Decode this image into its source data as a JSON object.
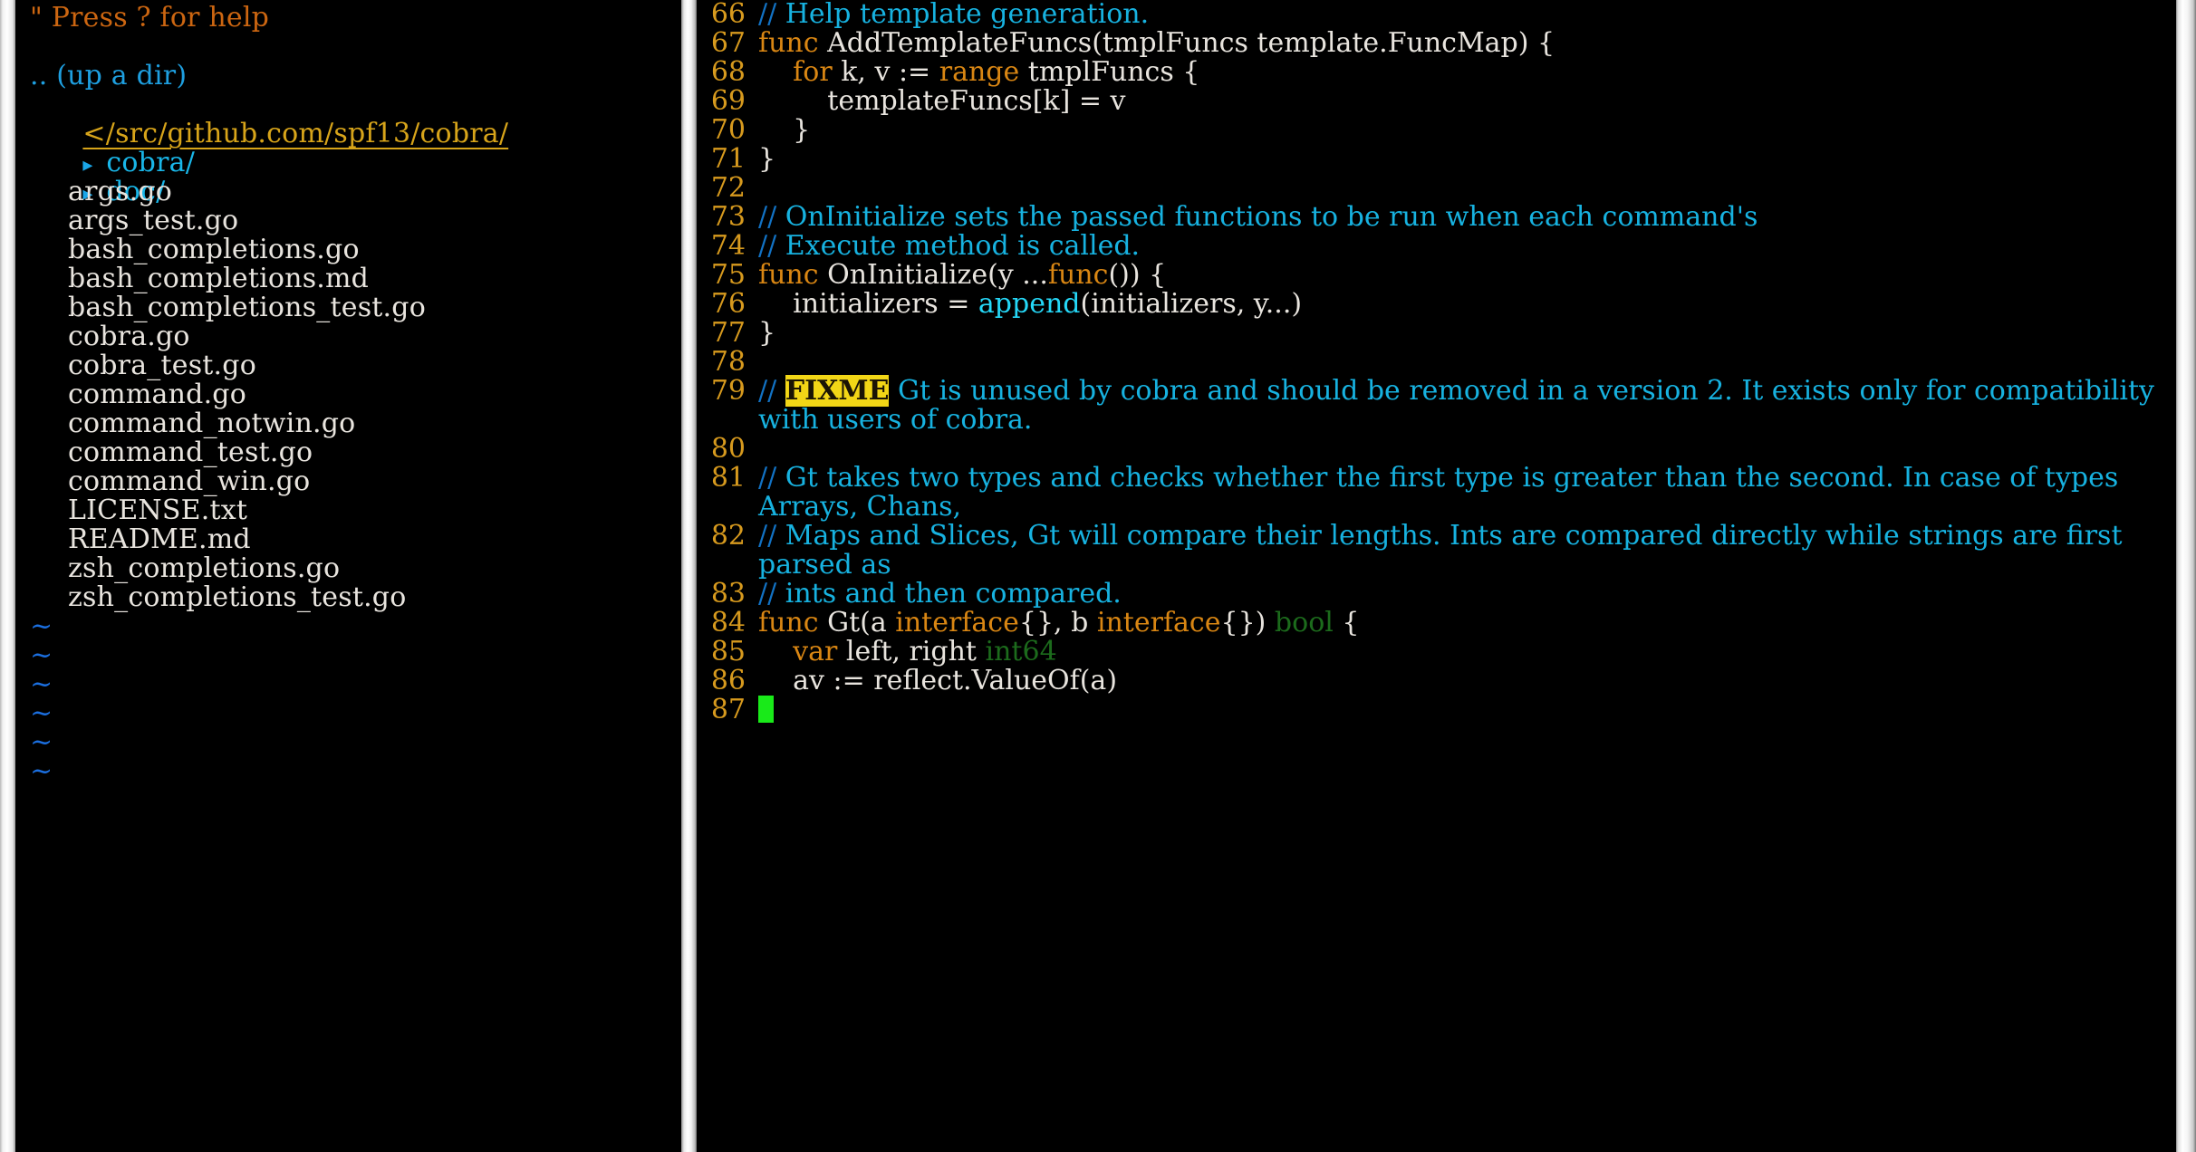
{
  "nerdtree": {
    "help_hint": "\" Press ? for help",
    "up_dir": ".. (up a dir)",
    "root_path": "</src/github.com/spf13/cobra/",
    "dirs": [
      {
        "arrow": "collapsed-arrow-icon",
        "label": "cobra/"
      },
      {
        "arrow": "collapsed-arrow-icon",
        "label": "doc/"
      }
    ],
    "files": [
      "args.go",
      "args_test.go",
      "bash_completions.go",
      "bash_completions.md",
      "bash_completions_test.go",
      "cobra.go",
      "cobra_test.go",
      "command.go",
      "command_notwin.go",
      "command_test.go",
      "command_win.go",
      "LICENSE.txt",
      "README.md",
      "zsh_completions.go",
      "zsh_completions_test.go"
    ],
    "tildes": [
      "~",
      "~",
      "~",
      "~",
      "~",
      "~"
    ]
  },
  "editor": {
    "lines": [
      {
        "num": "66",
        "tokens": [
          {
            "t": "// ",
            "c": "cmt-slash"
          },
          {
            "t": "Help template generation.",
            "c": "cmt"
          }
        ]
      },
      {
        "num": "67",
        "tokens": [
          {
            "t": "func",
            "c": "kw"
          },
          {
            "t": " AddTemplateFuncs(tmplFuncs template.FuncMap) {",
            "c": "plain"
          }
        ]
      },
      {
        "num": "68",
        "tokens": [
          {
            "t": "    ",
            "c": "plain"
          },
          {
            "t": "for",
            "c": "kw"
          },
          {
            "t": " k, v := ",
            "c": "plain"
          },
          {
            "t": "range",
            "c": "kw"
          },
          {
            "t": " tmplFuncs {",
            "c": "plain"
          }
        ]
      },
      {
        "num": "69",
        "tokens": [
          {
            "t": "        templateFuncs[k] = v",
            "c": "plain"
          }
        ]
      },
      {
        "num": "70",
        "tokens": [
          {
            "t": "    }",
            "c": "plain"
          }
        ]
      },
      {
        "num": "71",
        "tokens": [
          {
            "t": "}",
            "c": "plain"
          }
        ]
      },
      {
        "num": "72",
        "tokens": [
          {
            "t": "",
            "c": "plain"
          }
        ]
      },
      {
        "num": "73",
        "tokens": [
          {
            "t": "// ",
            "c": "cmt-slash"
          },
          {
            "t": "OnInitialize sets the passed functions to be run when each command's",
            "c": "cmt"
          }
        ]
      },
      {
        "num": "74",
        "tokens": [
          {
            "t": "// ",
            "c": "cmt-slash"
          },
          {
            "t": "Execute method is called.",
            "c": "cmt"
          }
        ]
      },
      {
        "num": "75",
        "tokens": [
          {
            "t": "func",
            "c": "kw"
          },
          {
            "t": " OnInitialize(y ...",
            "c": "plain"
          },
          {
            "t": "func",
            "c": "kw"
          },
          {
            "t": "()) {",
            "c": "plain"
          }
        ]
      },
      {
        "num": "76",
        "tokens": [
          {
            "t": "    initializers = ",
            "c": "plain"
          },
          {
            "t": "append",
            "c": "builtin"
          },
          {
            "t": "(initializers, y...)",
            "c": "plain"
          }
        ]
      },
      {
        "num": "77",
        "tokens": [
          {
            "t": "}",
            "c": "plain"
          }
        ]
      },
      {
        "num": "78",
        "tokens": [
          {
            "t": "",
            "c": "plain"
          }
        ]
      },
      {
        "num": "79",
        "tokens": [
          {
            "t": "// ",
            "c": "cmt-slash"
          },
          {
            "t": "FIXME",
            "c": "todo"
          },
          {
            "t": " Gt is unused by cobra and should be removed in a version 2. It exists only for compatibility with users of cobra.",
            "c": "cmt"
          }
        ]
      },
      {
        "num": "80",
        "tokens": [
          {
            "t": "",
            "c": "plain"
          }
        ]
      },
      {
        "num": "81",
        "tokens": [
          {
            "t": "// ",
            "c": "cmt-slash"
          },
          {
            "t": "Gt takes two types and checks whether the first type is greater than the second. In case of types Arrays, Chans,",
            "c": "cmt"
          }
        ]
      },
      {
        "num": "82",
        "tokens": [
          {
            "t": "// ",
            "c": "cmt-slash"
          },
          {
            "t": "Maps and Slices, Gt will compare their lengths. Ints are compared directly while strings are first parsed as",
            "c": "cmt"
          }
        ]
      },
      {
        "num": "83",
        "tokens": [
          {
            "t": "// ",
            "c": "cmt-slash"
          },
          {
            "t": "ints and then compared.",
            "c": "cmt"
          }
        ]
      },
      {
        "num": "84",
        "tokens": [
          {
            "t": "func",
            "c": "kw"
          },
          {
            "t": " Gt(a ",
            "c": "plain"
          },
          {
            "t": "interface",
            "c": "kw"
          },
          {
            "t": "{}, b ",
            "c": "plain"
          },
          {
            "t": "interface",
            "c": "kw"
          },
          {
            "t": "{}) ",
            "c": "plain"
          },
          {
            "t": "bool",
            "c": "type"
          },
          {
            "t": " {",
            "c": "plain"
          }
        ]
      },
      {
        "num": "85",
        "tokens": [
          {
            "t": "    ",
            "c": "plain"
          },
          {
            "t": "var",
            "c": "kw"
          },
          {
            "t": " left, right ",
            "c": "plain"
          },
          {
            "t": "int64",
            "c": "type"
          }
        ]
      },
      {
        "num": "86",
        "tokens": [
          {
            "t": "    av := reflect.ValueOf(a)",
            "c": "plain"
          }
        ]
      },
      {
        "num": "87",
        "tokens": [
          {
            "t": "",
            "c": "plain"
          }
        ],
        "cursor": true
      }
    ]
  },
  "colors": {
    "background": "#000000",
    "line_number": "#d79a1e",
    "comment": "#17b2e0",
    "keyword": "#d98613",
    "builtin": "#25d7f7",
    "type": "#1c6b1c",
    "todo_bg": "#f2d616",
    "cursor": "#19ea19",
    "directory": "#19b6e8",
    "file": "#e8e4de",
    "root_path": "#d7a41a",
    "help_hint": "#cc6611",
    "tilde": "#1b6fe0",
    "divider": "#ffffff"
  }
}
